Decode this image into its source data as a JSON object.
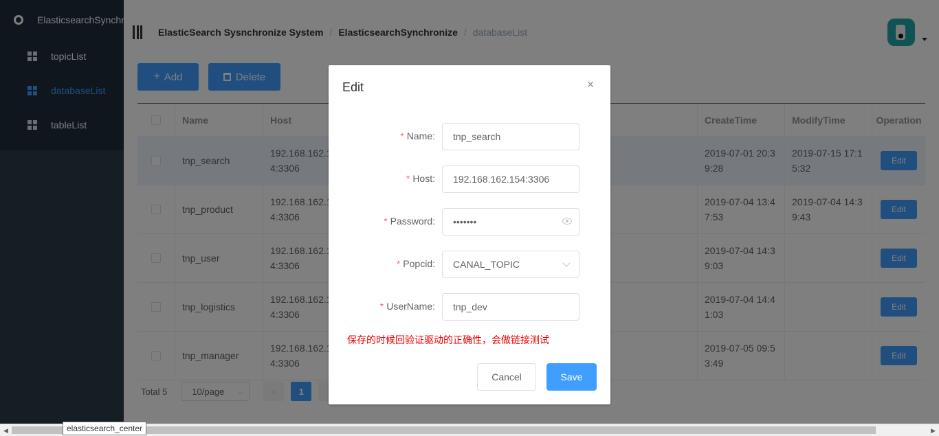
{
  "app": {
    "title": "ElasticsearchSynchronize"
  },
  "sidebar": {
    "items": [
      {
        "label": "topicList",
        "active": false
      },
      {
        "label": "databaseList",
        "active": true
      },
      {
        "label": "tableList",
        "active": false
      }
    ]
  },
  "breadcrumb": {
    "items": [
      "ElasticSearch Sysnchronize System",
      "ElasticsearchSynchronize",
      "databaseList"
    ],
    "separator": "/"
  },
  "toolbar": {
    "add_label": "Add",
    "delete_label": "Delete",
    "add_symbol": "+"
  },
  "table": {
    "columns": [
      "Name",
      "Host",
      "CreateTime",
      "ModifyTime",
      "Operation"
    ],
    "rows": [
      {
        "name": "tnp_search",
        "host1": "192.168.162.1",
        "host2": "4:3306",
        "create1": "2019-07-01 20:3",
        "create2": "9:28",
        "modify1": "2019-07-15 17:1",
        "modify2": "5:32",
        "op": "Edit"
      },
      {
        "name": "tnp_product",
        "host1": "192.168.162.1",
        "host2": "4:3306",
        "create1": "2019-07-04 13:4",
        "create2": "7:53",
        "modify1": "2019-07-04 14:3",
        "modify2": "9:43",
        "op": "Edit"
      },
      {
        "name": "tnp_user",
        "host1": "192.168.162.1",
        "host2": "4:3306",
        "create1": "2019-07-04 14:3",
        "create2": "9:03",
        "modify1": "",
        "modify2": "",
        "op": "Edit"
      },
      {
        "name": "tnp_logistics",
        "host1": "192.168.162.1",
        "host2": "4:3306",
        "create1": "2019-07-04 14:4",
        "create2": "1:03",
        "modify1": "",
        "modify2": "",
        "op": "Edit"
      },
      {
        "name": "tnp_manager",
        "host1": "192.168.162.1",
        "host2": "4:3306",
        "create1": "2019-07-05 09:5",
        "create2": "3:49",
        "modify1": "",
        "modify2": "",
        "op": "Edit"
      }
    ]
  },
  "pagination": {
    "total": "Total 5",
    "page_size": "10/page",
    "current_page": "1",
    "prev": "‹",
    "next": "›"
  },
  "dialog": {
    "title": "Edit",
    "close_symbol": "×",
    "fields": {
      "name": {
        "label": "Name:",
        "value": "tnp_search"
      },
      "host": {
        "label": "Host:",
        "value": "192.168.162.154:3306"
      },
      "password": {
        "label": "Password:",
        "value": "•••••••"
      },
      "popcid": {
        "label": "Popcid:",
        "value": "CANAL_TOPIC"
      },
      "username": {
        "label": "UserName:",
        "value": "tnp_dev"
      }
    },
    "required_mark": "*",
    "note": "保存的时候回验证驱动的正确性，会做链接测试",
    "cancel_label": "Cancel",
    "save_label": "Save"
  },
  "statusbar": {
    "tooltip": "elasticsearch_center",
    "arrow_left": "◀",
    "arrow_right": "▶"
  },
  "colors": {
    "primary": "#409eff",
    "sidebar_bg": "#1f2d3d",
    "danger": "#e00000"
  }
}
